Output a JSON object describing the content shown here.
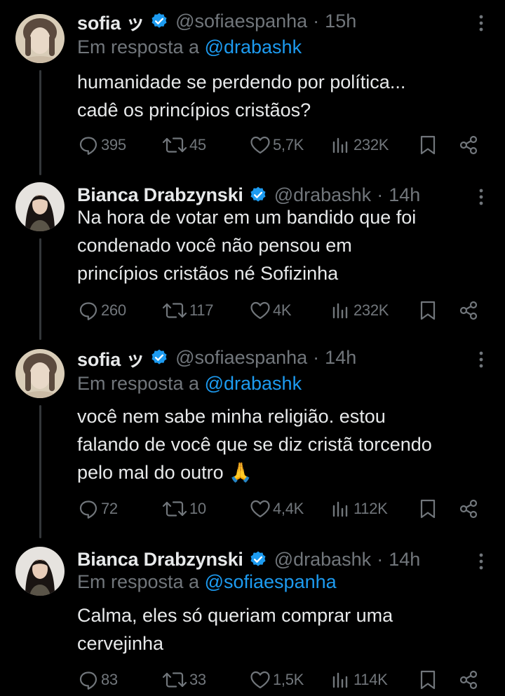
{
  "tweets": [
    {
      "name": "sofia ッ",
      "handle": "@sofiaespanha",
      "time": "15h",
      "reply_prefix": "Em resposta a",
      "reply_to": "@drabashk",
      "lines": [
        "humanidade se perdendo por política...",
        "cadê os princípios cristãos?"
      ],
      "replies": "395",
      "retweets": "45",
      "likes": "5,7K",
      "views": "232K"
    },
    {
      "name": "Bianca Drabzynski",
      "handle": "@drabashk",
      "time": "14h",
      "lines": [
        "Na hora de votar em um bandido que foi",
        "condenado você não pensou em",
        "princípios cristãos né Sofizinha"
      ],
      "replies": "260",
      "retweets": "117",
      "likes": "4K",
      "views": "232K"
    },
    {
      "name": "sofia ッ",
      "handle": "@sofiaespanha",
      "time": "14h",
      "reply_prefix": "Em resposta a",
      "reply_to": "@drabashk",
      "lines": [
        "você nem sabe minha religião. estou",
        "falando de você que se diz cristã torcendo",
        "pelo mal do outro 🙏"
      ],
      "replies": "72",
      "retweets": "10",
      "likes": "4,4K",
      "views": "112K"
    },
    {
      "name": "Bianca Drabzynski",
      "handle": "@drabashk",
      "time": "14h",
      "reply_prefix": "Em resposta a",
      "reply_to": "@sofiaespanha",
      "lines": [
        "Calma, eles só queriam comprar uma",
        "cervejinha"
      ],
      "replies": "83",
      "retweets": "33",
      "likes": "1,5K",
      "views": "114K"
    }
  ],
  "separator": "·",
  "colors": {
    "background": "#000000",
    "text": "#e7e9ea",
    "muted": "#71767b",
    "link": "#1d9bf0",
    "verified": "#1d9bf0",
    "thread_line": "#333639"
  },
  "icons": [
    "verified-badge-icon",
    "more-icon",
    "reply-icon",
    "retweet-icon",
    "like-icon",
    "views-icon",
    "bookmark-icon",
    "share-icon"
  ]
}
